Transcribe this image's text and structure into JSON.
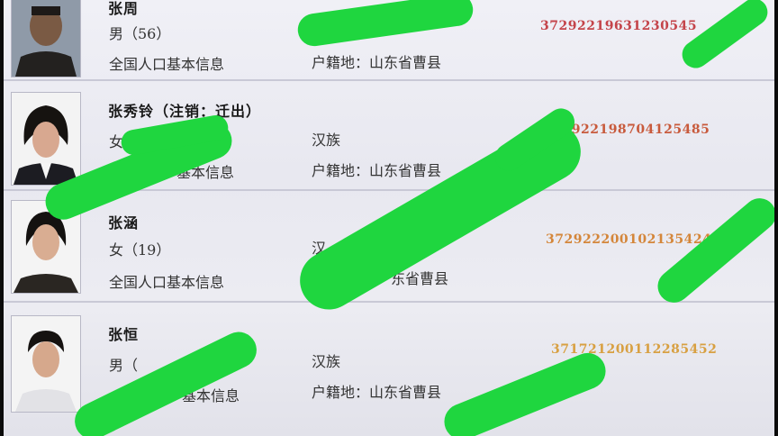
{
  "records": [
    {
      "name": "张周",
      "gender_age": "男（56）",
      "info_label": "全国人口基本信息",
      "ethnicity": "",
      "hukou": "户籍地：山东省曹县",
      "id_number": "37292219631230545"
    },
    {
      "name": "张秀铃（注销：迁出）",
      "gender_age": "女（",
      "info_label": "基本信息",
      "ethnicity": "汉族",
      "hukou": "户籍地：山东省曹县",
      "id_number": "372922198704125485"
    },
    {
      "name": "张涵",
      "gender_age": "女（19）",
      "info_label": "全国人口基本信息",
      "ethnicity": "汉",
      "hukou": "东省曹县",
      "id_number": "372922200102135424"
    },
    {
      "name": "张恒",
      "gender_age": "男（",
      "info_label": "基本信息",
      "ethnicity": "汉族",
      "hukou": "户籍地：山东省曹县",
      "id_number": "371721200112285452"
    }
  ],
  "colors": {
    "redaction": "#1fd63f",
    "id_red": "#c4444a",
    "id_orange": "#d4863a",
    "row_divider": "#c9c9d6"
  }
}
